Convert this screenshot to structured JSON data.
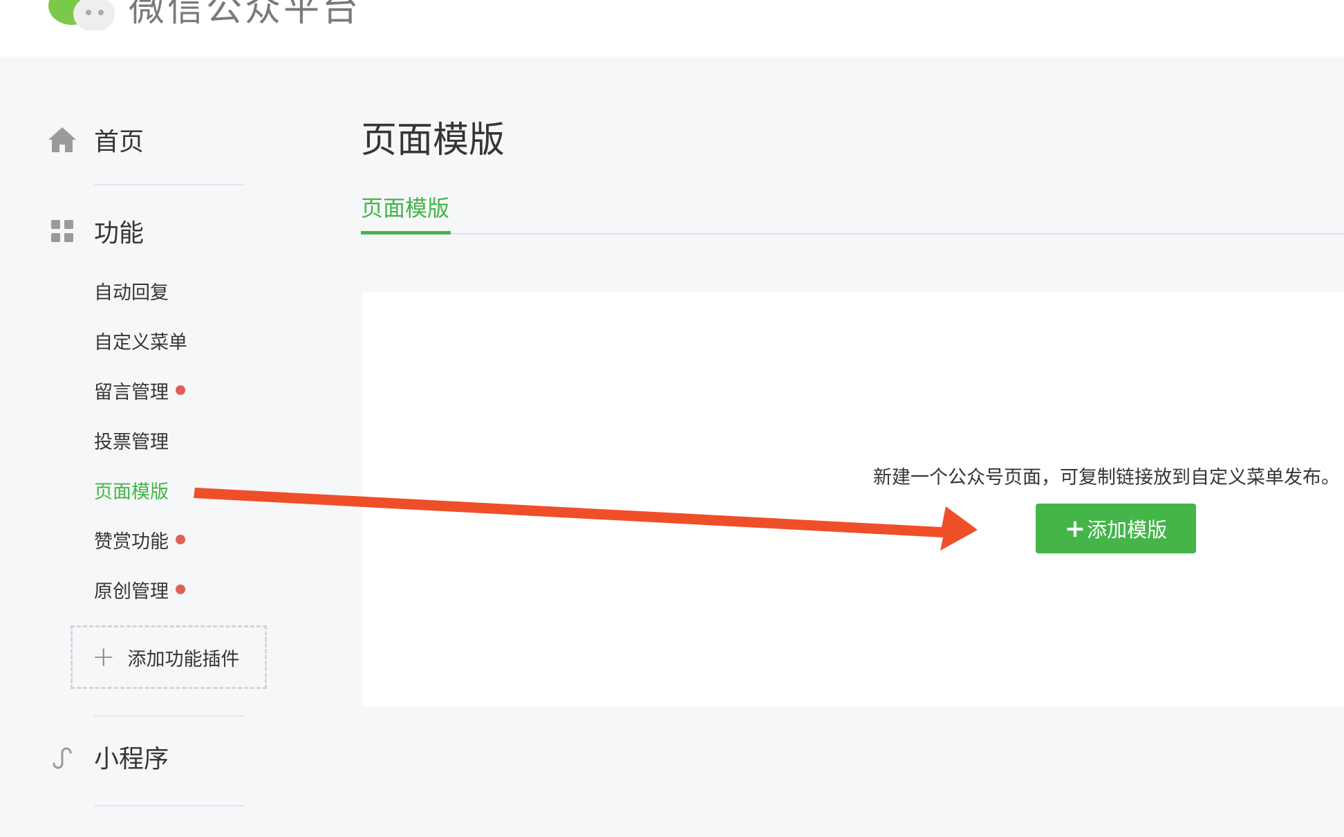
{
  "header": {
    "brand": "微信公众平台",
    "logo_icon": "wechat-logo-icon"
  },
  "sidebar": {
    "home": {
      "label": "首页",
      "icon": "home-icon"
    },
    "features": {
      "label": "功能",
      "icon": "grid-icon",
      "items": [
        {
          "label": "自动回复",
          "dot": false,
          "active": false
        },
        {
          "label": "自定义菜单",
          "dot": false,
          "active": false
        },
        {
          "label": "留言管理",
          "dot": true,
          "active": false
        },
        {
          "label": "投票管理",
          "dot": false,
          "active": false
        },
        {
          "label": "页面模版",
          "dot": false,
          "active": true
        },
        {
          "label": "赞赏功能",
          "dot": true,
          "active": false
        },
        {
          "label": "原创管理",
          "dot": true,
          "active": false
        }
      ],
      "add_plugin": {
        "plus": "+",
        "label": "添加功能插件"
      }
    },
    "miniprogram": {
      "label": "小程序",
      "icon": "link-icon"
    }
  },
  "main": {
    "title": "页面模版",
    "tabs": [
      {
        "label": "页面模版",
        "active": true
      }
    ],
    "hint": "新建一个公众号页面，可复制链接放到自定义菜单发布。",
    "add_button": {
      "plus": "+",
      "label": "添加模版"
    }
  },
  "colors": {
    "accent": "#44b549",
    "dot": "#e15f5b",
    "arrow": "#ee4f28"
  }
}
